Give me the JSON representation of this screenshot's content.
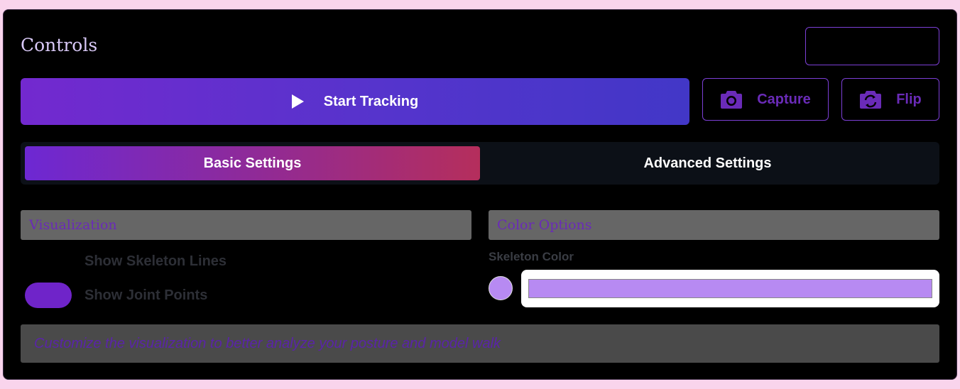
{
  "controls": {
    "title": "Controls",
    "start_label": "Start Tracking",
    "capture_label": "Capture",
    "flip_label": "Flip"
  },
  "tabs": [
    {
      "label": "Basic Settings",
      "active": true
    },
    {
      "label": "Advanced Settings",
      "active": false
    }
  ],
  "visualization": {
    "header": "Visualization",
    "show_skeleton_lines": {
      "label": "Show Skeleton Lines",
      "on": false
    },
    "show_joint_points": {
      "label": "Show Joint Points",
      "on": true
    }
  },
  "color_options": {
    "header": "Color Options",
    "skeleton_color_label": "Skeleton Color",
    "skeleton_color": "#b78af2"
  },
  "hint": "Customize the visualization to better analyze your posture and model walk",
  "colors": {
    "accent": "#7329cf",
    "accent_text": "#6a2bb8",
    "page_bg": "#f9d4ec"
  },
  "icons": {
    "start": "play-icon",
    "capture": "camera-icon",
    "flip": "flip-camera-icon"
  }
}
